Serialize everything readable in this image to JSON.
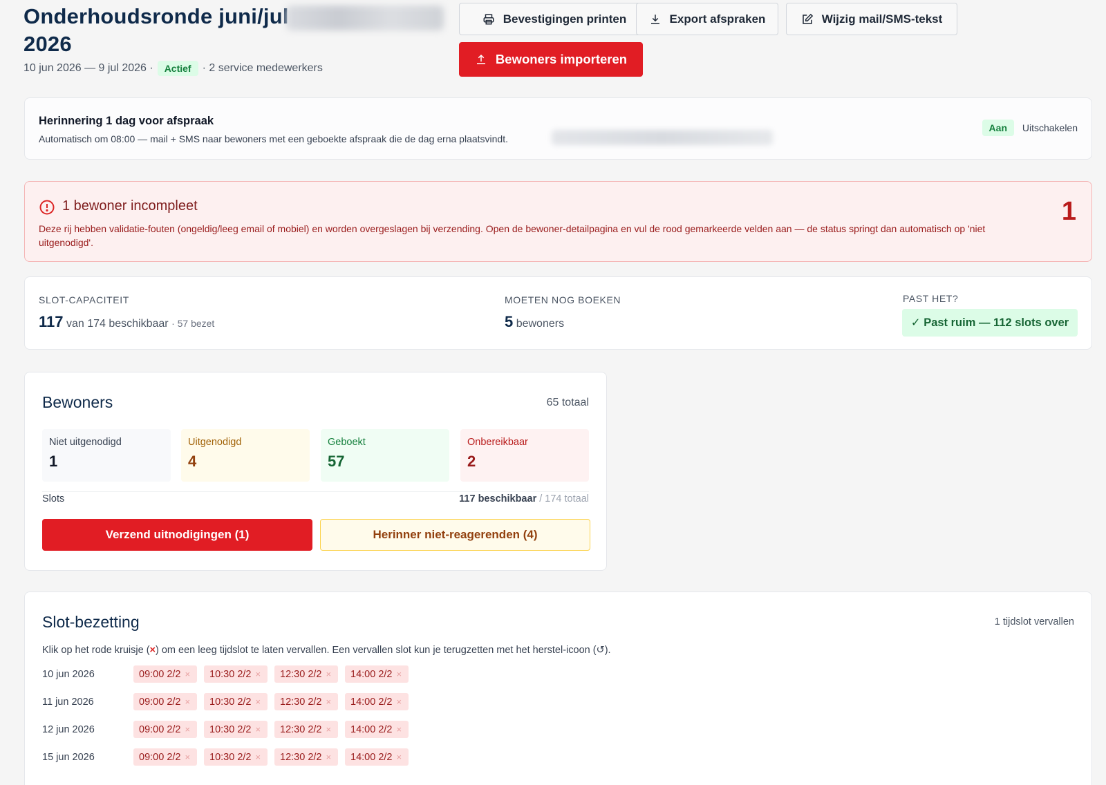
{
  "header": {
    "title": "Onderhoudsronde juni/jul",
    "title_line2": "2026",
    "date_range": "10 jun 2026 — 9 jul 2026 ·",
    "status": "Actief",
    "staff": "· 2 service medewerkers"
  },
  "actions": {
    "print": "Bevestigingen printen",
    "export": "Export afspraken",
    "edit_text": "Wijzig mail/SMS-tekst",
    "import": "Bewoners importeren"
  },
  "reminder": {
    "title": "Herinnering 1 dag voor afspraak",
    "text": "Automatisch om 08:00 — mail + SMS naar bewoners met een geboekte afspraak die de dag erna plaatsvindt.",
    "state": "Aan",
    "toggle": "Uitschakelen"
  },
  "alert": {
    "title": "1 bewoner incompleet",
    "text": "Deze rij hebben validatie-fouten (ongeldig/leeg email of mobiel) en worden overgeslagen bij verzending. Open de bewoner-detailpagina en vul de rood gemarkeerde velden aan — de status springt dan automatisch op 'niet uitgenodigd'.",
    "count": "1"
  },
  "capacity": {
    "slot_label": "SLOT-CAPACITEIT",
    "available": "117",
    "of_total": "van 174 beschikbaar",
    "taken": "· 57 bezet",
    "todo_label": "MOETEN NOG BOEKEN",
    "todo_count": "5",
    "todo_unit": "bewoners",
    "fit_label": "PAST HET?",
    "fit_value": "✓ Past ruim — 112 slots over"
  },
  "residents": {
    "title": "Bewoners",
    "total": "65 totaal",
    "stats": [
      {
        "label": "Niet uitgenodigd",
        "value": "1",
        "bg": "#f8f9fb",
        "fg": "#111827",
        "lc": "#374151"
      },
      {
        "label": "Uitgenodigd",
        "value": "4",
        "bg": "#fffbeb",
        "fg": "#92400e",
        "lc": "#a16207"
      },
      {
        "label": "Geboekt",
        "value": "57",
        "bg": "#f0fdf4",
        "fg": "#166534",
        "lc": "#15803d"
      },
      {
        "label": "Onbereikbaar",
        "value": "2",
        "bg": "#fef2f2",
        "fg": "#991b1b",
        "lc": "#b91c1c"
      }
    ],
    "slots_label": "Slots",
    "slots_available": "117 beschikbaar",
    "slots_total": "/ 174 totaal",
    "send_button": "Verzend uitnodigingen (1)",
    "remind_button": "Herinner niet-reagerenden (4)"
  },
  "slots": {
    "title": "Slot-bezetting",
    "expired": "1 tijdslot vervallen",
    "help_before": "Klik op het rode kruisje (",
    "help_x": "×",
    "help_after": ") om een leeg tijdslot te laten vervallen. Een vervallen slot kun je terugzetten met het herstel-icoon (↺).",
    "days": [
      {
        "date": "10 jun 2026",
        "chips": [
          "09:00 2/2",
          "10:30 2/2",
          "12:30 2/2",
          "14:00 2/2"
        ]
      },
      {
        "date": "11 jun 2026",
        "chips": [
          "09:00 2/2",
          "10:30 2/2",
          "12:30 2/2",
          "14:00 2/2"
        ]
      },
      {
        "date": "12 jun 2026",
        "chips": [
          "09:00 2/2",
          "10:30 2/2",
          "12:30 2/2",
          "14:00 2/2"
        ]
      },
      {
        "date": "15 jun 2026",
        "chips": [
          "09:00 2/2",
          "10:30 2/2",
          "12:30 2/2",
          "14:00 2/2"
        ]
      }
    ]
  },
  "colors": {
    "brand_red": "#e11d24",
    "navy": "#0f2a4a",
    "success": "#15803d"
  }
}
